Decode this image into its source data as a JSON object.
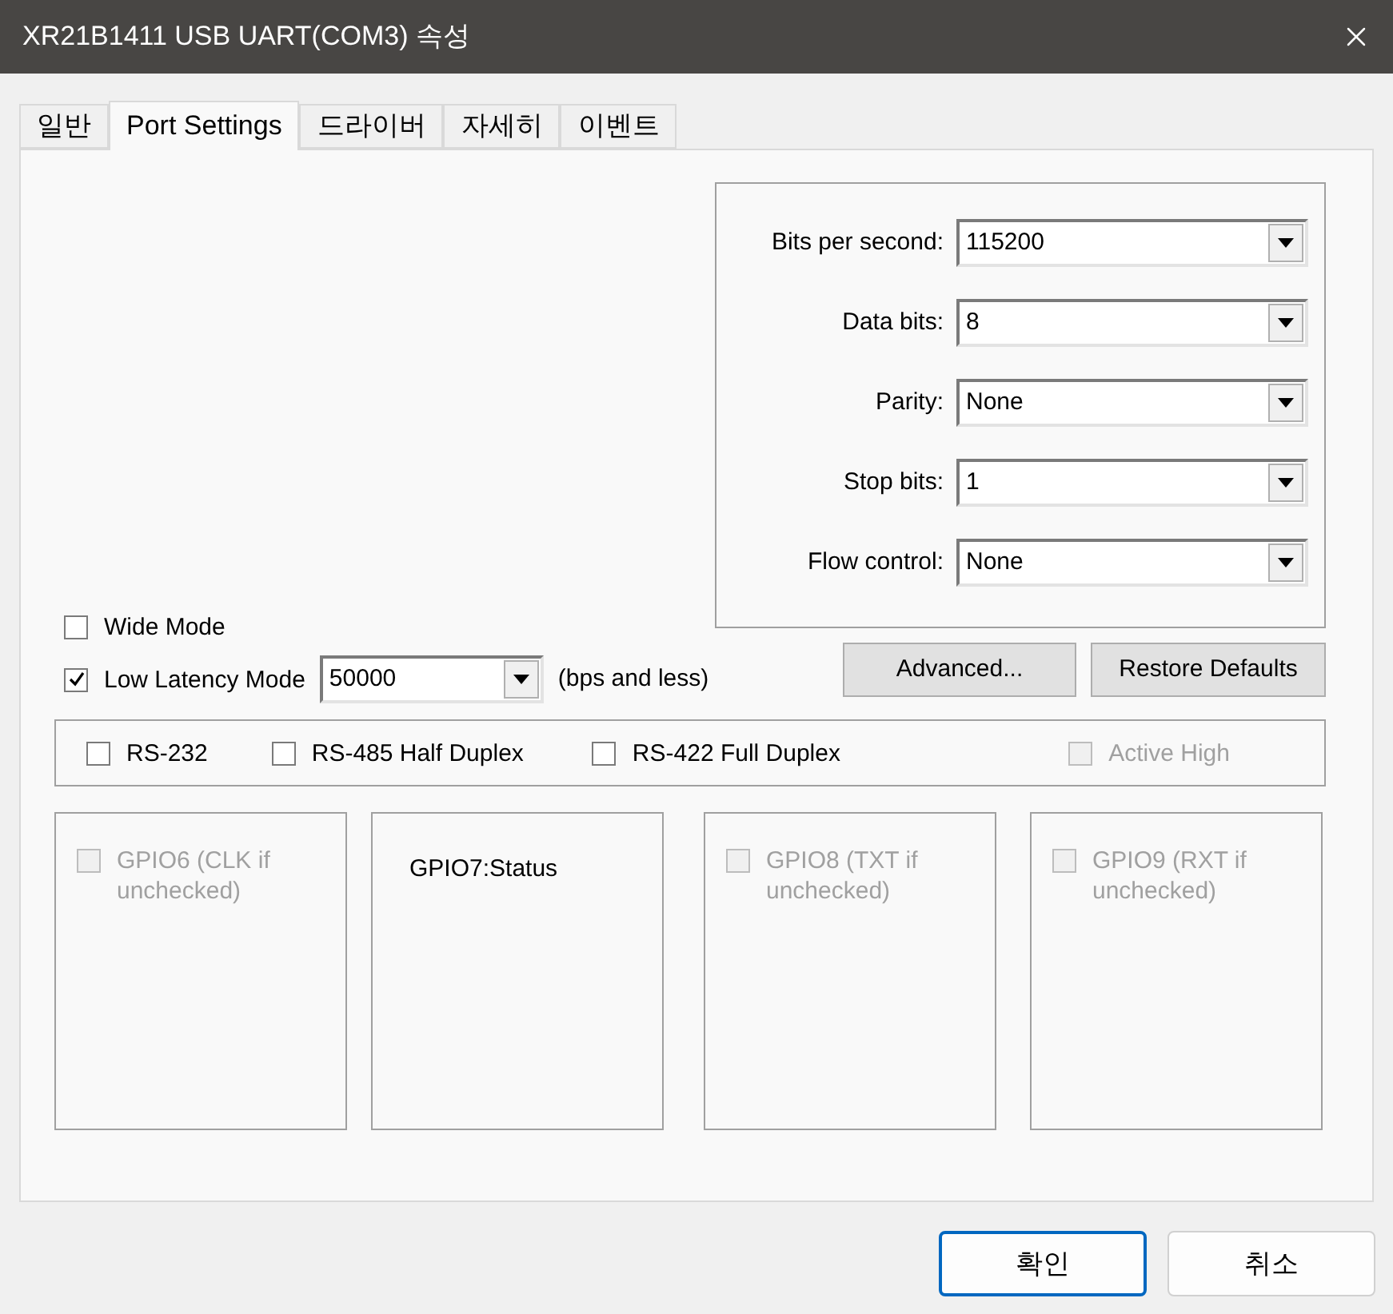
{
  "window": {
    "title": "XR21B1411 USB UART(COM3) 속성"
  },
  "tabs": [
    {
      "label": "일반",
      "selected": false
    },
    {
      "label": "Port Settings",
      "selected": true
    },
    {
      "label": "드라이버",
      "selected": false
    },
    {
      "label": "자세히",
      "selected": false
    },
    {
      "label": "이벤트",
      "selected": false
    }
  ],
  "serial_settings": [
    {
      "label": "Bits per second:",
      "value": "115200"
    },
    {
      "label": "Data bits:",
      "value": "8"
    },
    {
      "label": "Parity:",
      "value": "None"
    },
    {
      "label": "Stop bits:",
      "value": "1"
    },
    {
      "label": "Flow control:",
      "value": "None"
    }
  ],
  "wide_mode": {
    "label": "Wide Mode",
    "checked": false
  },
  "low_latency": {
    "label": "Low Latency Mode",
    "checked": true,
    "value": "50000",
    "note": "(bps and less)"
  },
  "action_buttons": [
    "Advanced...",
    "Restore Defaults"
  ],
  "modes": [
    {
      "label": "RS-232",
      "checked": false,
      "disabled": false
    },
    {
      "label": "RS-485 Half Duplex",
      "checked": false,
      "disabled": false
    },
    {
      "label": "RS-422 Full Duplex",
      "checked": false,
      "disabled": false
    },
    {
      "label": "Active High",
      "checked": false,
      "disabled": true
    }
  ],
  "gpio": [
    {
      "kind": "checkbox",
      "label": "GPIO6 (CLK if unchecked)",
      "checked": false,
      "disabled": true
    },
    {
      "kind": "text",
      "label": "GPIO7:Status"
    },
    {
      "kind": "checkbox",
      "label": "GPIO8 (TXT if unchecked)",
      "checked": false,
      "disabled": true
    },
    {
      "kind": "checkbox",
      "label": "GPIO9 (RXT if unchecked)",
      "checked": false,
      "disabled": true
    }
  ],
  "footer_buttons": [
    {
      "label": "확인",
      "default": true
    },
    {
      "label": "취소",
      "default": false
    }
  ]
}
